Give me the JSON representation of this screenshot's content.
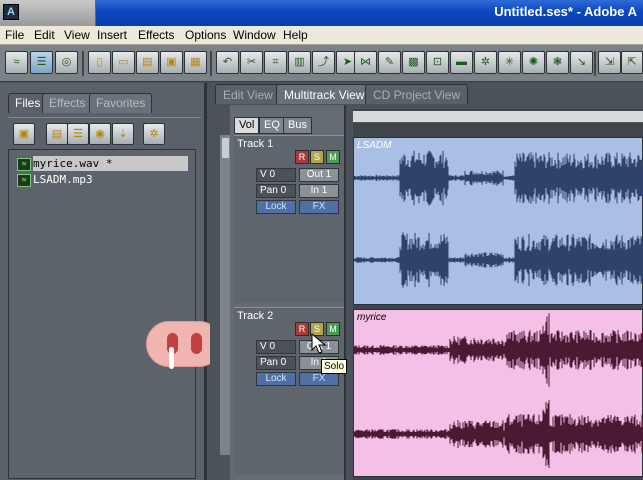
{
  "window": {
    "title": "Untitled.ses* - Adobe A",
    "app_icon": "A"
  },
  "menu": [
    "File",
    "Edit",
    "View",
    "Insert",
    "Effects",
    "Options",
    "Window",
    "Help"
  ],
  "toolbar": {
    "icons": [
      "waveform-icon",
      "multitrack-icon",
      "cd-icon",
      "new-icon",
      "open-icon",
      "open-append-icon",
      "save-icon",
      "save-all-icon",
      "undo-icon",
      "cut-icon",
      "crop-icon",
      "trim-icon",
      "split-icon",
      "envelope-icon",
      "mix-icon",
      "loop-icon",
      "record-icon",
      "lock-icon",
      "group-icon",
      "snap-icon",
      "time-icon",
      "fx-icon",
      "eq-icon",
      "analysis-icon",
      "zoom-icon"
    ]
  },
  "files_panel": {
    "tabs": [
      "Files",
      "Effects",
      "Favorites"
    ],
    "active_tab": "Files",
    "files": [
      {
        "name": "myrice.wav *",
        "selected": true
      },
      {
        "name": "LSADM.mp3",
        "selected": false
      }
    ]
  },
  "view_tabs": {
    "items": [
      "Edit View",
      "Multitrack View",
      "CD Project View"
    ],
    "active": "Multitrack View"
  },
  "track_panel": {
    "subtabs": [
      "Vol",
      "EQ",
      "Bus"
    ],
    "active_subtab": "Vol",
    "tracks": [
      {
        "name": "Track 1",
        "r": "R",
        "s": "S",
        "m": "M",
        "vol": "V 0",
        "pan": "Pan 0",
        "out": "Out 1",
        "in": "In 1",
        "lock": "Lock",
        "fx": "FX"
      },
      {
        "name": "Track 2",
        "r": "R",
        "s": "S",
        "m": "M",
        "vol": "V 0",
        "pan": "Pan 0",
        "out": "Out 1",
        "in": "In 1",
        "lock": "Lock",
        "fx": "FX"
      }
    ]
  },
  "clips": [
    {
      "name": "LSADM",
      "color": "#a9bfe4",
      "wave_color": "#2f4268"
    },
    {
      "name": "myrice",
      "color": "#f5c0e8",
      "wave_color": "#4a1a33"
    }
  ],
  "tooltip": "Solo"
}
